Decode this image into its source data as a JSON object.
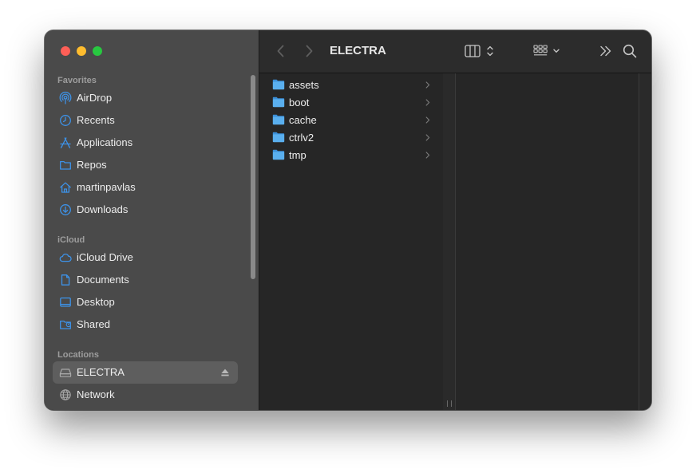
{
  "window": {
    "title": "ELECTRA"
  },
  "sidebar": {
    "sections": [
      {
        "title": "Favorites",
        "items": [
          {
            "label": "AirDrop",
            "icon": "airdrop-icon"
          },
          {
            "label": "Recents",
            "icon": "clock-icon"
          },
          {
            "label": "Applications",
            "icon": "applications-icon"
          },
          {
            "label": "Repos",
            "icon": "folder-icon"
          },
          {
            "label": "martinpavlas",
            "icon": "home-icon"
          },
          {
            "label": "Downloads",
            "icon": "download-icon"
          }
        ]
      },
      {
        "title": "iCloud",
        "items": [
          {
            "label": "iCloud Drive",
            "icon": "cloud-icon"
          },
          {
            "label": "Documents",
            "icon": "document-icon"
          },
          {
            "label": "Desktop",
            "icon": "desktop-icon"
          },
          {
            "label": "Shared",
            "icon": "shared-folder-icon"
          }
        ]
      },
      {
        "title": "Locations",
        "items": [
          {
            "label": "ELECTRA",
            "icon": "drive-icon",
            "selected": true,
            "ejectable": true
          },
          {
            "label": "Network",
            "icon": "globe-icon"
          }
        ]
      }
    ]
  },
  "folder": {
    "items": [
      {
        "label": "assets",
        "icon": "folder-icon"
      },
      {
        "label": "boot",
        "icon": "folder-icon"
      },
      {
        "label": "cache",
        "icon": "folder-icon"
      },
      {
        "label": "ctrlv2",
        "icon": "folder-icon"
      },
      {
        "label": "tmp",
        "icon": "folder-icon"
      }
    ]
  },
  "colors": {
    "accent": "#3d92e8",
    "folder_blue": "#5aafee",
    "sidebar_bg": "#4a4a4a",
    "content_bg": "#262626"
  }
}
